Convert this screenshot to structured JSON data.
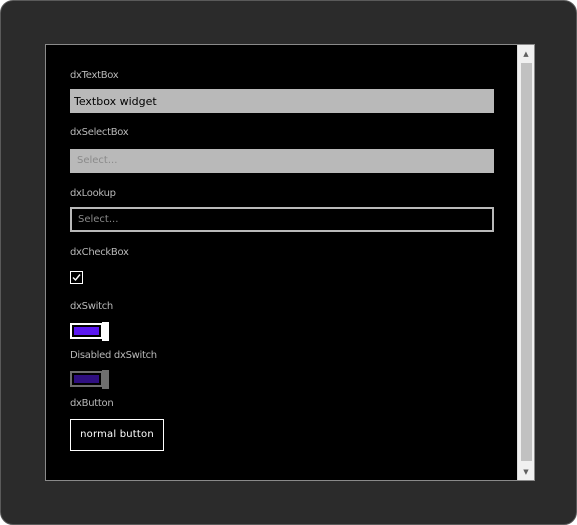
{
  "fields": {
    "textbox": {
      "label": "dxTextBox",
      "value": "Textbox widget"
    },
    "selectbox": {
      "label": "dxSelectBox",
      "placeholder": "Select..."
    },
    "lookup": {
      "label": "dxLookup",
      "placeholder": "Select..."
    },
    "checkbox": {
      "label": "dxCheckBox",
      "checked": true
    },
    "switch": {
      "label": "dxSwitch",
      "on": true
    },
    "disabled_switch": {
      "label": "Disabled dxSwitch",
      "on": true,
      "disabled": true
    },
    "button": {
      "label": "dxButton",
      "text": "normal button"
    }
  },
  "colors": {
    "frame": "#2b2b2b",
    "viewport": "#000000",
    "field": "#b9b9b9",
    "switch_on": "#5b17f0",
    "switch_on_disabled": "#2f0f80"
  },
  "scrollbar": {
    "up_icon": "triangle-up",
    "down_icon": "triangle-down"
  }
}
